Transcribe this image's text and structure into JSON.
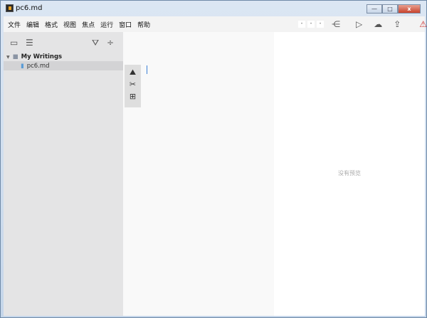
{
  "window": {
    "title": "pc6.md",
    "buttons": {
      "minimize": "—",
      "maximize": "□",
      "close": "x"
    }
  },
  "menu": [
    "文件",
    "编辑",
    "格式",
    "视图",
    "焦点",
    "运行",
    "窗口",
    "帮助"
  ],
  "toolbar": {
    "dots": [
      "•",
      "•",
      "•"
    ]
  },
  "sidebar": {
    "root": "My Writings",
    "file": "pc6.md"
  },
  "preview": {
    "empty_text": "没有预览"
  }
}
